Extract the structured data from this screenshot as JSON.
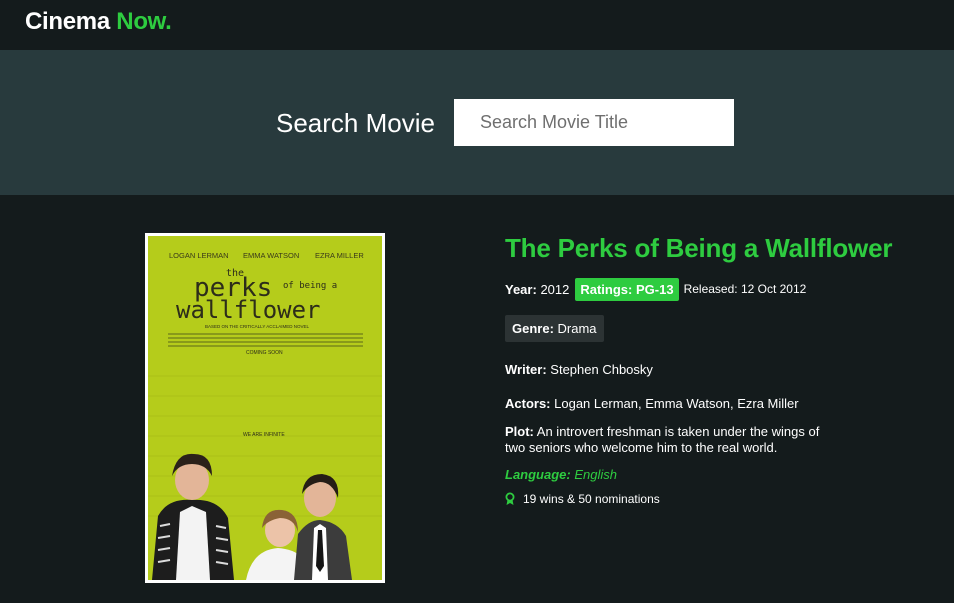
{
  "brand": {
    "name": "Cinema",
    "accent": "Now."
  },
  "search": {
    "label": "Search Movie",
    "placeholder": "Search Movie Title",
    "value": ""
  },
  "poster": {
    "actors": [
      "LOGAN LERMAN",
      "EMMA WATSON",
      "EZRA MILLER"
    ],
    "title_top": "the",
    "title_main": "perks",
    "title_small": "of being a",
    "title_bottom": "wallflower",
    "tagline": "BASED ON THE CRITICALLY ACCLAIMED NOVEL",
    "coming_soon": "COMING SOON",
    "slogan": "WE ARE INFINITE"
  },
  "movie": {
    "title": "The Perks of Being a Wallflower",
    "year_label": "Year:",
    "year": "2012",
    "rating_label": "Ratings:",
    "rating": "PG-13",
    "released_label": "Released:",
    "released": "12 Oct 2012",
    "genre_label": "Genre:",
    "genre": "Drama",
    "writer_label": "Writer:",
    "writer": "Stephen Chbosky",
    "actors_label": "Actors:",
    "actors": "Logan Lerman, Emma Watson, Ezra Miller",
    "plot_label": "Plot:",
    "plot": "An introvert freshman is taken under the wings of two seniors who welcome him to the real world.",
    "language_label": "Language:",
    "language": "English",
    "awards": "19 wins & 50 nominations"
  },
  "colors": {
    "accent": "#2ecc40",
    "background": "#141b1c",
    "band": "#283a3d",
    "poster_bg": "#b5cc1b"
  },
  "icons": {
    "awards": "award-ribbon-icon"
  }
}
